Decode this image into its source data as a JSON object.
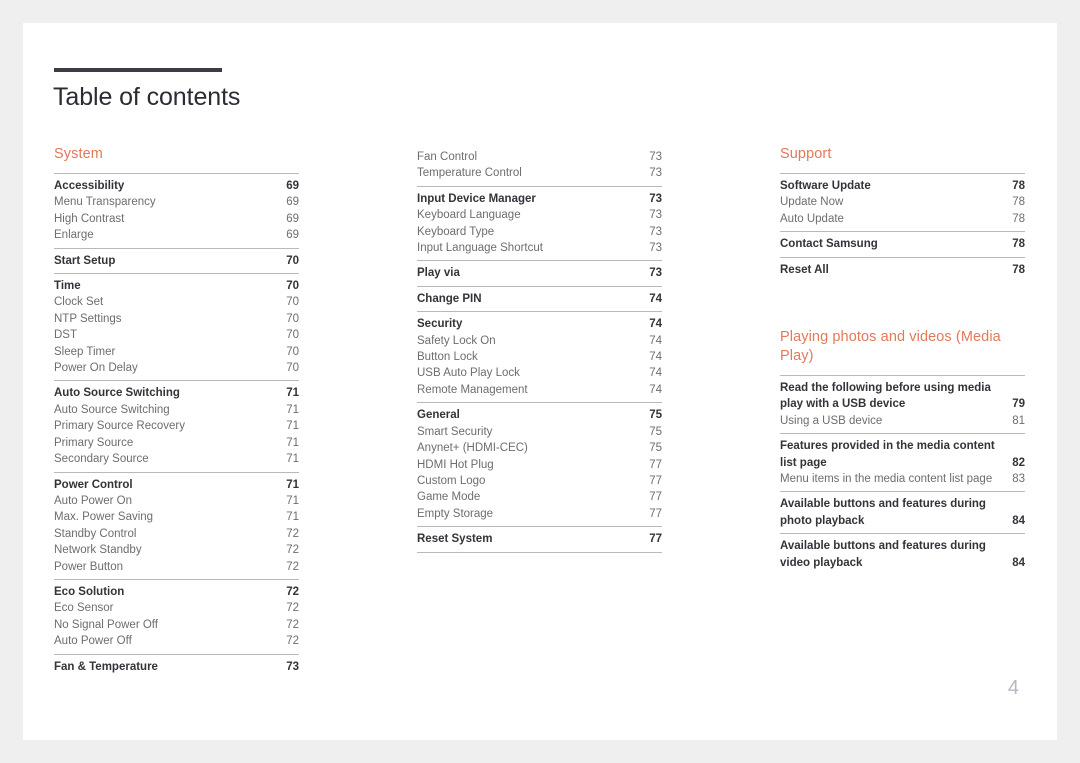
{
  "document": {
    "title": "Table of contents",
    "folio": "4",
    "accent_color": "#e2795a",
    "rule_color": "#b9b9b9",
    "title_bar_color": "#3c3c47"
  },
  "columns": [
    {
      "id": "column-1",
      "blocks": [
        {
          "type": "heading",
          "text": "System"
        },
        {
          "type": "group",
          "entries": [
            {
              "label": "Accessibility",
              "page": "69",
              "level": 1
            },
            {
              "label": "Menu Transparency",
              "page": "69",
              "level": 2
            },
            {
              "label": "High Contrast",
              "page": "69",
              "level": 2
            },
            {
              "label": "Enlarge",
              "page": "69",
              "level": 2
            }
          ]
        },
        {
          "type": "group",
          "entries": [
            {
              "label": "Start Setup",
              "page": "70",
              "level": 1
            }
          ]
        },
        {
          "type": "group",
          "entries": [
            {
              "label": "Time",
              "page": "70",
              "level": 1
            },
            {
              "label": "Clock Set",
              "page": "70",
              "level": 2
            },
            {
              "label": "NTP Settings",
              "page": "70",
              "level": 2
            },
            {
              "label": "DST",
              "page": "70",
              "level": 2
            },
            {
              "label": "Sleep Timer",
              "page": "70",
              "level": 2
            },
            {
              "label": "Power On Delay",
              "page": "70",
              "level": 2
            }
          ]
        },
        {
          "type": "group",
          "entries": [
            {
              "label": "Auto Source Switching",
              "page": "71",
              "level": 1
            },
            {
              "label": "Auto Source Switching",
              "page": "71",
              "level": 2
            },
            {
              "label": "Primary Source Recovery",
              "page": "71",
              "level": 2
            },
            {
              "label": "Primary Source",
              "page": "71",
              "level": 2
            },
            {
              "label": "Secondary Source",
              "page": "71",
              "level": 2
            }
          ]
        },
        {
          "type": "group",
          "entries": [
            {
              "label": "Power Control",
              "page": "71",
              "level": 1
            },
            {
              "label": "Auto Power On",
              "page": "71",
              "level": 2
            },
            {
              "label": "Max. Power Saving",
              "page": "71",
              "level": 2
            },
            {
              "label": "Standby Control",
              "page": "72",
              "level": 2
            },
            {
              "label": "Network Standby",
              "page": "72",
              "level": 2
            },
            {
              "label": "Power Button",
              "page": "72",
              "level": 2
            }
          ]
        },
        {
          "type": "group",
          "entries": [
            {
              "label": "Eco Solution",
              "page": "72",
              "level": 1
            },
            {
              "label": "Eco Sensor",
              "page": "72",
              "level": 2
            },
            {
              "label": "No Signal Power Off",
              "page": "72",
              "level": 2
            },
            {
              "label": "Auto Power Off",
              "page": "72",
              "level": 2
            }
          ]
        },
        {
          "type": "group",
          "entries": [
            {
              "label": "Fan & Temperature",
              "page": "73",
              "level": 1
            }
          ]
        }
      ]
    },
    {
      "id": "column-2",
      "blocks": [
        {
          "type": "group",
          "no_rule": true,
          "entries": [
            {
              "label": "Fan Control",
              "page": "73",
              "level": 2
            },
            {
              "label": "Temperature Control",
              "page": "73",
              "level": 2
            }
          ]
        },
        {
          "type": "group",
          "entries": [
            {
              "label": "Input Device Manager",
              "page": "73",
              "level": 1
            },
            {
              "label": "Keyboard Language",
              "page": "73",
              "level": 2
            },
            {
              "label": "Keyboard Type",
              "page": "73",
              "level": 2
            },
            {
              "label": "Input Language Shortcut",
              "page": "73",
              "level": 2
            }
          ]
        },
        {
          "type": "group",
          "entries": [
            {
              "label": "Play via",
              "page": "73",
              "level": 1
            }
          ]
        },
        {
          "type": "group",
          "entries": [
            {
              "label": "Change PIN",
              "page": "74",
              "level": 1
            }
          ]
        },
        {
          "type": "group",
          "entries": [
            {
              "label": "Security",
              "page": "74",
              "level": 1
            },
            {
              "label": "Safety Lock On",
              "page": "74",
              "level": 2
            },
            {
              "label": "Button Lock",
              "page": "74",
              "level": 2
            },
            {
              "label": "USB Auto Play Lock",
              "page": "74",
              "level": 2
            },
            {
              "label": "Remote Management",
              "page": "74",
              "level": 2
            }
          ]
        },
        {
          "type": "group",
          "entries": [
            {
              "label": "General",
              "page": "75",
              "level": 1
            },
            {
              "label": "Smart Security",
              "page": "75",
              "level": 2
            },
            {
              "label": "Anynet+ (HDMI-CEC)",
              "page": "75",
              "level": 2
            },
            {
              "label": "HDMI Hot Plug",
              "page": "77",
              "level": 2
            },
            {
              "label": "Custom Logo",
              "page": "77",
              "level": 2
            },
            {
              "label": "Game Mode",
              "page": "77",
              "level": 2
            },
            {
              "label": "Empty Storage",
              "page": "77",
              "level": 2
            }
          ]
        },
        {
          "type": "group",
          "last": true,
          "entries": [
            {
              "label": "Reset System",
              "page": "77",
              "level": 1
            }
          ]
        }
      ]
    },
    {
      "id": "column-3",
      "blocks": [
        {
          "type": "heading",
          "text": "Support"
        },
        {
          "type": "group",
          "entries": [
            {
              "label": "Software Update",
              "page": "78",
              "level": 1
            },
            {
              "label": "Update Now",
              "page": "78",
              "level": 2
            },
            {
              "label": "Auto Update",
              "page": "78",
              "level": 2
            }
          ]
        },
        {
          "type": "group",
          "entries": [
            {
              "label": "Contact Samsung",
              "page": "78",
              "level": 1
            }
          ]
        },
        {
          "type": "group",
          "entries": [
            {
              "label": "Reset All",
              "page": "78",
              "level": 1
            }
          ]
        },
        {
          "type": "heading",
          "spaced": true,
          "text": "Playing photos and videos (Media Play)"
        },
        {
          "type": "group",
          "entries": [
            {
              "label": "Read the following before using media play with a USB device",
              "page": "79",
              "level": 1
            },
            {
              "label": "Using a USB device",
              "page": "81",
              "level": 2
            }
          ]
        },
        {
          "type": "group",
          "entries": [
            {
              "label": "Features provided in the media content list page",
              "page": "82",
              "level": 1
            },
            {
              "label": "Menu items in the media content list page",
              "page": "83",
              "level": 2
            }
          ]
        },
        {
          "type": "group",
          "entries": [
            {
              "label": "Available buttons and features during photo playback",
              "page": "84",
              "level": 1
            }
          ]
        },
        {
          "type": "group",
          "entries": [
            {
              "label": "Available buttons and features during video playback",
              "page": "84",
              "level": 1
            }
          ]
        }
      ]
    }
  ]
}
